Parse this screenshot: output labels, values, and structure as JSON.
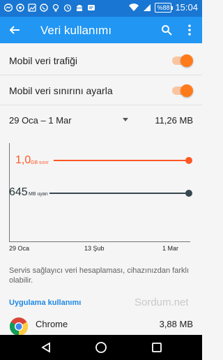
{
  "status_bar": {
    "time": "15:04",
    "battery": "%88",
    "icons": [
      "messenger-icon",
      "photo-icon",
      "image-icon",
      "whatsapp-icon",
      "lightbulb-icon",
      "alarm-icon",
      "android-icon",
      "messages-icon",
      "wifi-icon",
      "signal-icon"
    ]
  },
  "app_bar": {
    "title": "Veri kullanımı",
    "back_icon": "arrow-back-icon",
    "search_icon": "search-icon",
    "more_icon": "more-vert-icon"
  },
  "settings": {
    "mobile_data": {
      "label": "Mobil veri trafiği",
      "enabled": true
    },
    "data_limit": {
      "label": "Mobil veri sınırını ayarla",
      "enabled": true
    }
  },
  "cycle": {
    "range": "29 Oca – 1 Mar",
    "usage": "11,26 MB"
  },
  "chart": {
    "limit_value": "1,0",
    "limit_unit": "GB sınır",
    "warning_value": "645",
    "warning_unit": "MB uyarı",
    "x_ticks": [
      "29 Oca",
      "13 Şub",
      "1 Mar"
    ]
  },
  "note": "Servis sağlayıcı veri hesaplaması, cihazınızdan farklı olabilir.",
  "section_header": "Uygulama kullanımı",
  "watermark": "Sordum.net",
  "apps": [
    {
      "name": "Chrome",
      "usage": "3,88 MB",
      "icon": "chrome-icon"
    }
  ],
  "nav_bar": {
    "back_icon": "nav-back-icon",
    "home_icon": "nav-home-icon",
    "recents_icon": "nav-recents-icon"
  },
  "colors": {
    "status_bar": "#1976d2",
    "app_bar": "#2196f3",
    "accent": "#ff7a1a",
    "limit": "#ff5722",
    "warning": "#37474f",
    "link": "#1e88e5"
  }
}
